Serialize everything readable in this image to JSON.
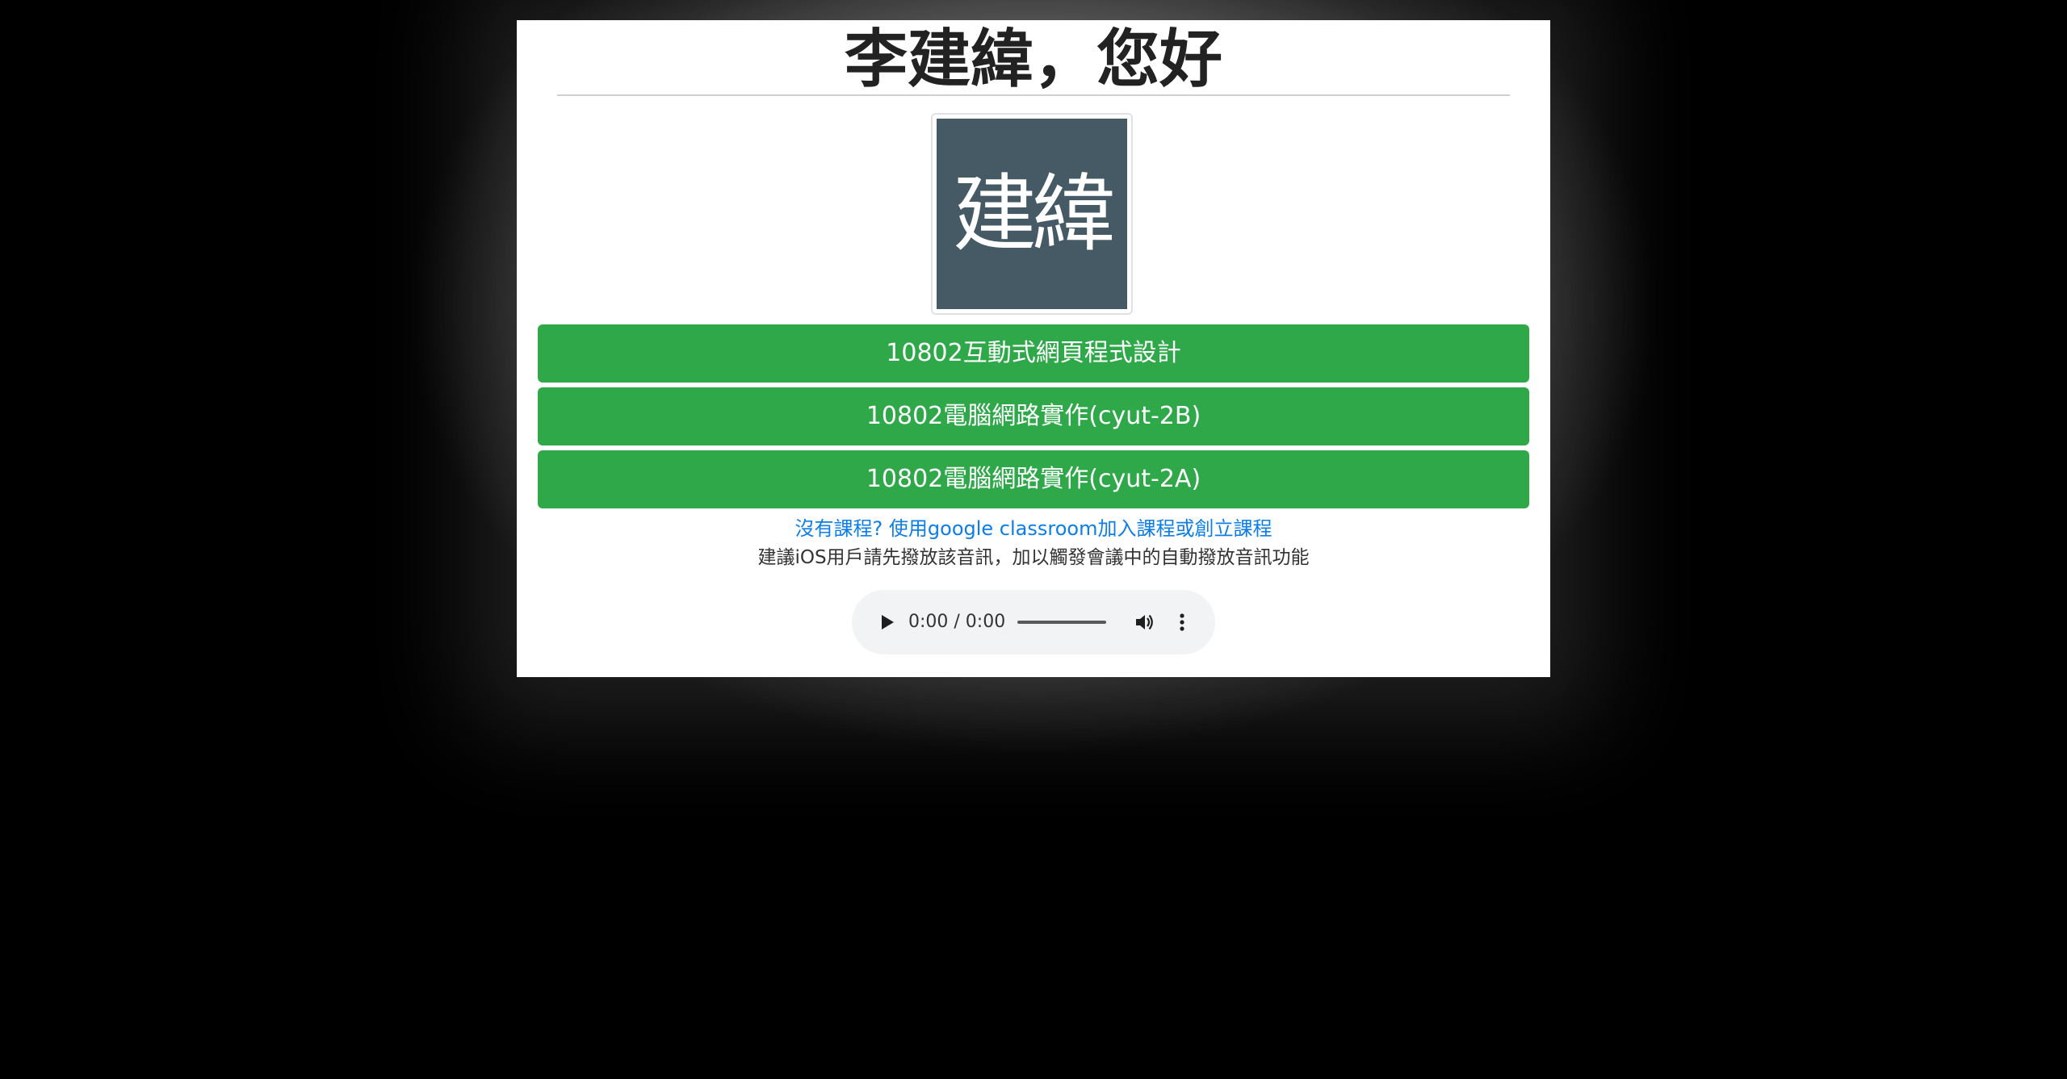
{
  "greeting": {
    "title": "李建緯，您好"
  },
  "avatar": {
    "text": "建緯",
    "bg_color": "#455a64"
  },
  "courses": [
    {
      "label": "10802互動式網頁程式設計"
    },
    {
      "label": "10802電腦網路實作(cyut-2B)"
    },
    {
      "label": "10802電腦網路實作(cyut-2A)"
    }
  ],
  "course_button_color": "#2fa84a",
  "help_link": {
    "text": "沒有課程? 使用google classroom加入課程或創立課程"
  },
  "note": {
    "text": "建議iOS用戶請先撥放該音訊，加以觸發會議中的自動撥放音訊功能"
  },
  "audio_player": {
    "time": "0:00 / 0:00",
    "play_icon": "play-icon",
    "volume_icon": "volume-icon",
    "more_icon": "more-vert-icon"
  }
}
